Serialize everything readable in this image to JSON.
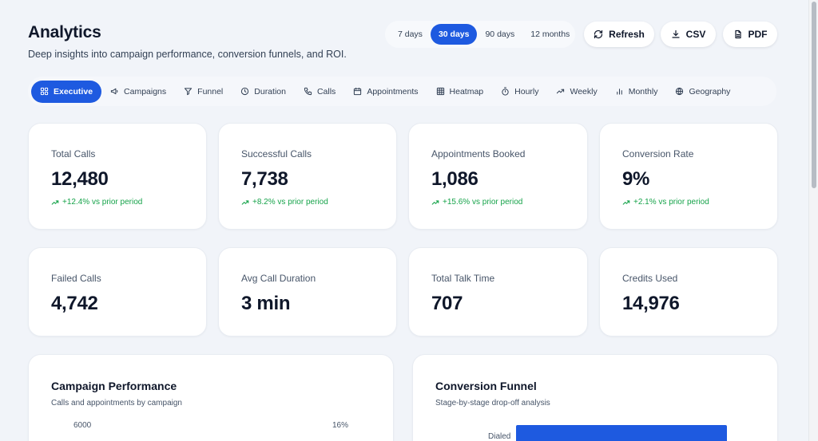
{
  "header": {
    "title": "Analytics",
    "subtitle": "Deep insights into campaign performance, conversion funnels, and ROI."
  },
  "ranges": {
    "options": [
      "7 days",
      "30 days",
      "90 days",
      "12 months"
    ],
    "selected": "30 days"
  },
  "actions": {
    "refresh": "Refresh",
    "csv": "CSV",
    "pdf": "PDF"
  },
  "tabs": [
    {
      "label": "Executive",
      "icon": "grid-icon",
      "active": true
    },
    {
      "label": "Campaigns",
      "icon": "megaphone-icon"
    },
    {
      "label": "Funnel",
      "icon": "funnel-icon"
    },
    {
      "label": "Duration",
      "icon": "clock-icon"
    },
    {
      "label": "Calls",
      "icon": "phone-icon"
    },
    {
      "label": "Appointments",
      "icon": "calendar-icon"
    },
    {
      "label": "Heatmap",
      "icon": "heatmap-grid-icon"
    },
    {
      "label": "Hourly",
      "icon": "timer-icon"
    },
    {
      "label": "Weekly",
      "icon": "trending-up-icon"
    },
    {
      "label": "Monthly",
      "icon": "bar-chart-icon"
    },
    {
      "label": "Geography",
      "icon": "globe-icon"
    }
  ],
  "stats_row1": [
    {
      "label": "Total Calls",
      "value": "12,480",
      "trend": "+12.4% vs prior period"
    },
    {
      "label": "Successful Calls",
      "value": "7,738",
      "trend": "+8.2% vs prior period"
    },
    {
      "label": "Appointments Booked",
      "value": "1,086",
      "trend": "+15.6% vs prior period"
    },
    {
      "label": "Conversion Rate",
      "value": "9%",
      "trend": "+2.1% vs prior period"
    }
  ],
  "stats_row2": [
    {
      "label": "Failed Calls",
      "value": "4,742"
    },
    {
      "label": "Avg Call Duration",
      "value": "3 min"
    },
    {
      "label": "Total Talk Time",
      "value": "707"
    },
    {
      "label": "Credits Used",
      "value": "14,976"
    }
  ],
  "campaign_performance": {
    "title": "Campaign Performance",
    "subtitle": "Calls and appointments by campaign",
    "left_axis_top": "6000",
    "right_axis_top": "16%"
  },
  "conversion_funnel": {
    "title": "Conversion Funnel",
    "subtitle": "Stage-by-stage drop-off analysis",
    "stages": [
      {
        "label": "Dialed"
      }
    ]
  },
  "colors": {
    "accent": "#1e5ae0",
    "positive": "#16a34a",
    "background": "#f1f4f9"
  }
}
